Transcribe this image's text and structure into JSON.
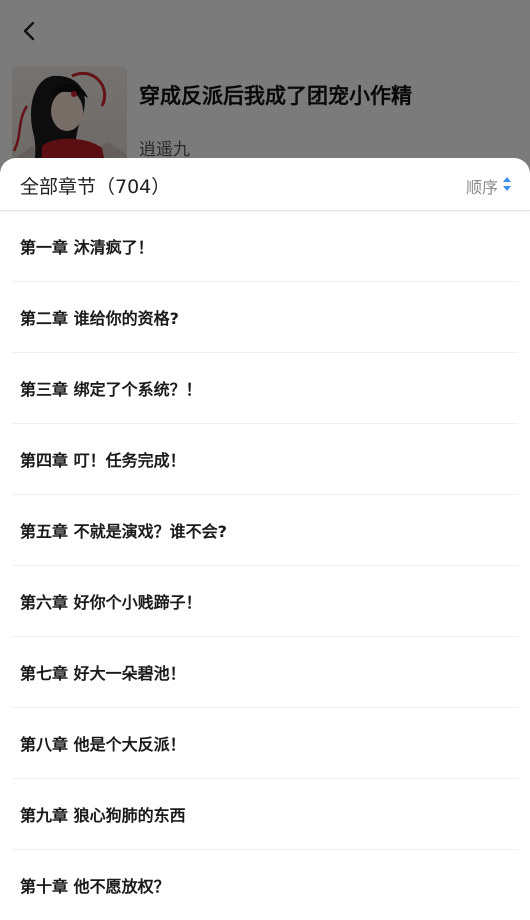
{
  "book": {
    "title": "穿成反派后我成了团宠小作精",
    "author": "逍遥九"
  },
  "toc": {
    "title": "全部章节（704）",
    "sort_label": "顺序",
    "chapters": [
      "第一章  沐清疯了！",
      "第二章 谁给你的资格?",
      "第三章  绑定了个系统？！",
      "第四章  叮！任务完成！",
      "第五章  不就是演戏？谁不会?",
      "第六章 好你个小贱蹄子！",
      "第七章 好大一朵碧池！",
      "第八章  他是个大反派！",
      "第九章  狼心狗肺的东西",
      "第十章  他不愿放权？"
    ]
  },
  "colors": {
    "sort_up": "#3a8ef6",
    "sort_down": "#3a8ef6"
  },
  "icons": [
    "back-arrow-icon",
    "sort-arrows-icon"
  ]
}
